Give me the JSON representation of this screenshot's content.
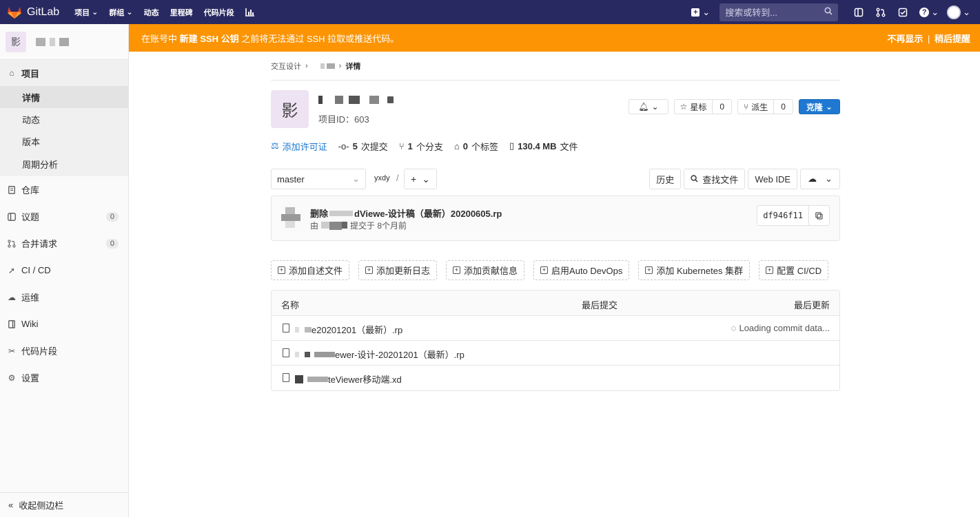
{
  "navbar": {
    "brand": "GitLab",
    "links": [
      {
        "label": "项目",
        "caret": true
      },
      {
        "label": "群组",
        "caret": true
      },
      {
        "label": "动态",
        "caret": false
      },
      {
        "label": "里程碑",
        "caret": false
      },
      {
        "label": "代码片段",
        "caret": false
      }
    ],
    "search_placeholder": "搜索或转到...",
    "colors": {
      "bg": "#292961",
      "logo": "#e24329"
    }
  },
  "sidebar": {
    "project_avatar": "影",
    "section_title": "项目",
    "sub_items": [
      "详情",
      "动态",
      "版本",
      "周期分析"
    ],
    "items": [
      {
        "label": "仓库",
        "icon": "doc-icon",
        "badge": null
      },
      {
        "label": "议题",
        "icon": "issues-icon",
        "badge": "0"
      },
      {
        "label": "合并请求",
        "icon": "merge-icon",
        "badge": "0"
      },
      {
        "label": "CI / CD",
        "icon": "rocket-icon",
        "badge": null
      },
      {
        "label": "运维",
        "icon": "cloud-icon",
        "badge": null
      },
      {
        "label": "Wiki",
        "icon": "book-icon",
        "badge": null
      },
      {
        "label": "代码片段",
        "icon": "scissors-icon",
        "badge": null
      },
      {
        "label": "设置",
        "icon": "gear-icon",
        "badge": null
      }
    ],
    "collapse_label": "收起侧边栏"
  },
  "alert": {
    "pre": "在账号中 ",
    "bold": "新建 SSH 公钥",
    "post": " 之前将无法通过 SSH 拉取或推送代码。",
    "dismiss": "不再显示",
    "sep": "|",
    "later": "稍后提醒",
    "color": "#fc9403"
  },
  "breadcrumb": {
    "first": "交互设计",
    "sep": "›",
    "current": "详情"
  },
  "project": {
    "avatar": "影",
    "id_label": "项目ID：603",
    "star_label": "星标",
    "star_count": "0",
    "fork_label": "派生",
    "fork_count": "0",
    "clone_label": "克隆"
  },
  "stats": {
    "license": "添加许可证",
    "commits_num": "5",
    "commits": "次提交",
    "branches_num": "1",
    "branches": "个分支",
    "tags_num": "0",
    "tags": "个标签",
    "size_num": "130.4 MB",
    "size": "文件"
  },
  "tree": {
    "branch": "master",
    "path": "yxdy",
    "slash": "/",
    "history": "历史",
    "find_file": "查找文件",
    "web_ide": "Web IDE"
  },
  "commit": {
    "title_pre": "删除",
    "title_post": "dViewe-设计稿（最新）20200605.rp",
    "by": "由",
    "when": "提交于 8个月前",
    "sha": "df946f11"
  },
  "quick_actions": [
    "添加自述文件",
    "添加更新日志",
    "添加贡献信息",
    "启用Auto DevOps",
    "添加 Kubernetes 集群",
    "配置 CI/CD"
  ],
  "table": {
    "col_name": "名称",
    "col_commit": "最后提交",
    "col_update": "最后更新",
    "rows": [
      {
        "name": "e20201201（最新）.rp"
      },
      {
        "name": "ewer-设计-20201201（最新）.rp"
      },
      {
        "name": "teViewer移动端.xd"
      }
    ],
    "loading": "Loading commit data..."
  }
}
